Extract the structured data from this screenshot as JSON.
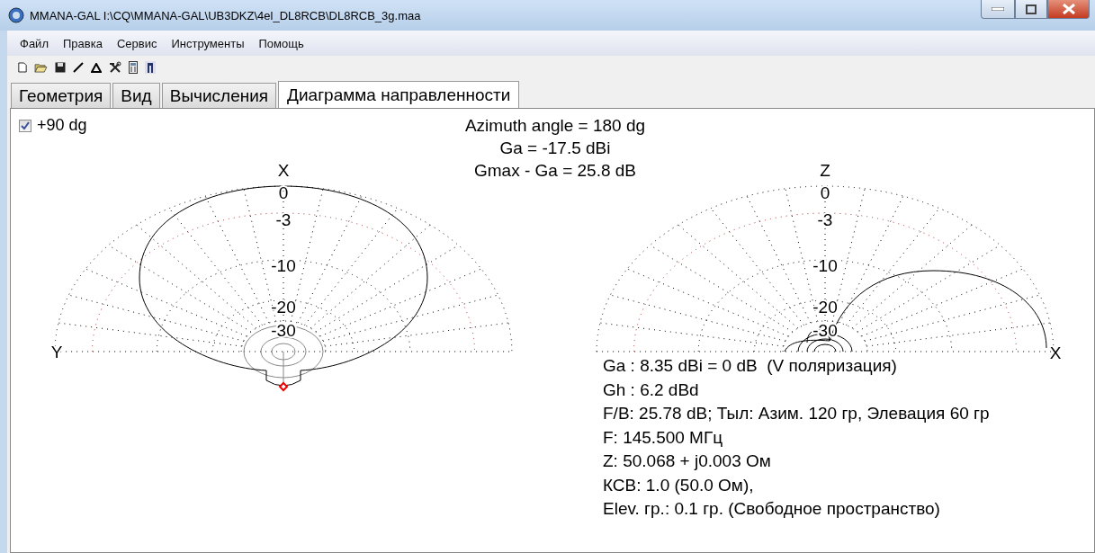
{
  "window": {
    "title": "MMANA-GAL I:\\CQ\\MMANA-GAL\\UB3DKZ\\4el_DL8RCB\\DL8RCB_3g.maa"
  },
  "menu": [
    "Файл",
    "Правка",
    "Сервис",
    "Инструменты",
    "Помощь"
  ],
  "toolbar": [
    {
      "kind": "new"
    },
    {
      "kind": "open"
    },
    {
      "kind": "save"
    },
    {
      "kind": "line"
    },
    {
      "kind": "triangle"
    },
    {
      "kind": "tools"
    },
    {
      "kind": "calculator"
    },
    {
      "kind": "export"
    }
  ],
  "tabs": [
    {
      "label": "Геометрия",
      "selected": false
    },
    {
      "label": "Вид",
      "selected": false
    },
    {
      "label": "Вычисления",
      "selected": false
    },
    {
      "label": "Диаграмма направленности",
      "selected": true
    }
  ],
  "checkbox": {
    "label": "+90 dg",
    "checked": true
  },
  "header": [
    "Azimuth angle = 180 dg",
    "Ga = -17.5 dBi",
    "Gmax - Ga = 25.8 dB"
  ],
  "plots": [
    {
      "kind": "horizontal",
      "axis_top": "X",
      "axis_side": "Y",
      "ring_labels": [
        "0",
        "-3",
        "-10",
        "-20",
        "-30"
      ]
    },
    {
      "kind": "vertical",
      "axis_top": "Z",
      "axis_side": "X",
      "ring_labels": [
        "0",
        "-3",
        "-10",
        "-20",
        "-30"
      ]
    }
  ],
  "results": [
    "Ga : 8.35 dBi = 0 dB  (V поляризация)",
    "Gh : 6.2 dBd",
    "F/B: 25.78 dB; Тыл: Азим. 120 гр, Элевация 60 гр",
    "F: 145.500 МГц",
    "Z: 50.068 + j0.003 Ом",
    "КСВ: 1.0 (50.0 Ом),",
    "Elev. гр.: 0.1 гр. (Свободное пространство)"
  ]
}
